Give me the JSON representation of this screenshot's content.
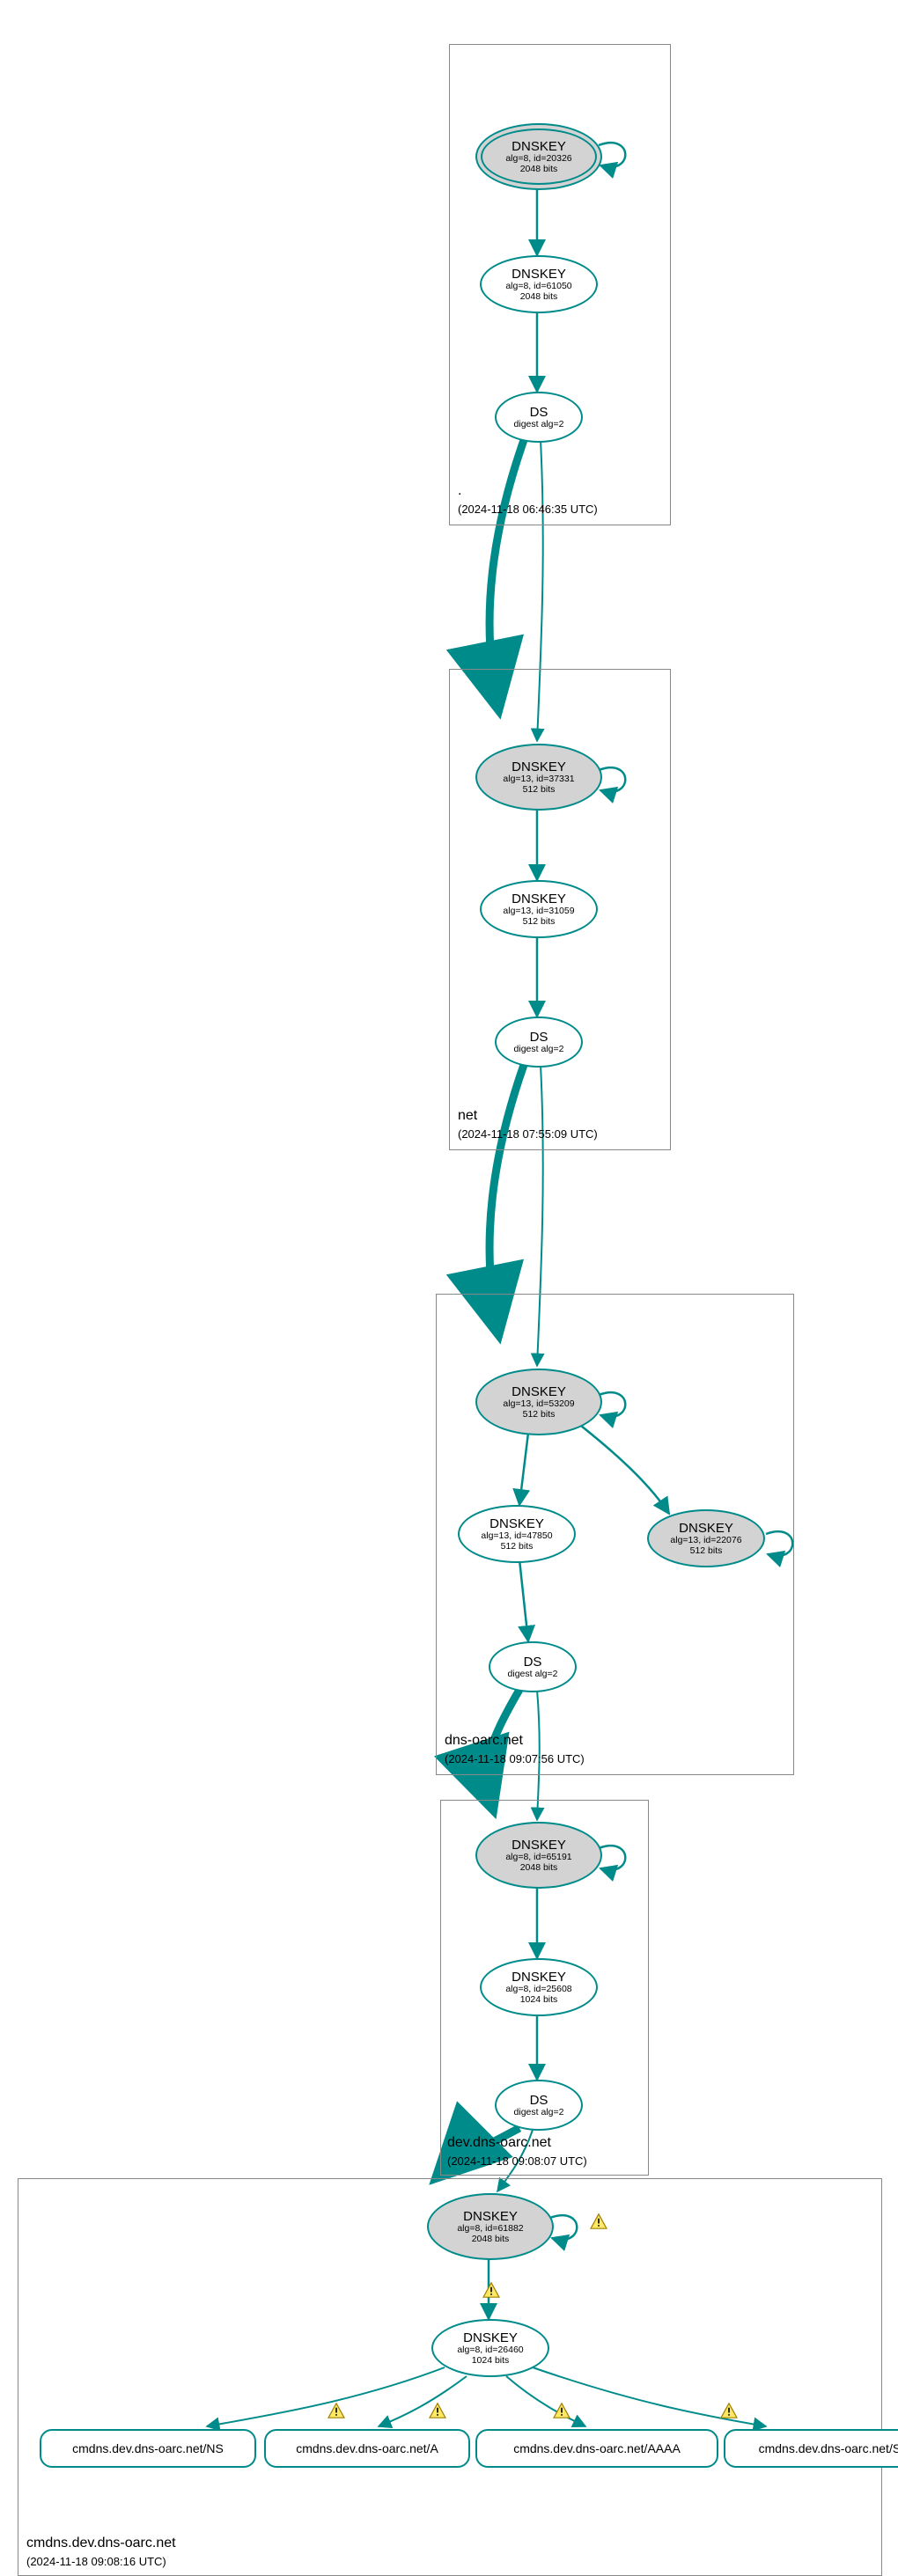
{
  "zones": {
    "root": {
      "name": ".",
      "timestamp": "(2024-11-18 06:46:35 UTC)"
    },
    "net": {
      "name": "net",
      "timestamp": "(2024-11-18 07:55:09 UTC)"
    },
    "dnsoarc": {
      "name": "dns-oarc.net",
      "timestamp": "(2024-11-18 09:07:56 UTC)"
    },
    "dev": {
      "name": "dev.dns-oarc.net",
      "timestamp": "(2024-11-18 09:08:07 UTC)"
    },
    "cmdns": {
      "name": "cmdns.dev.dns-oarc.net",
      "timestamp": "(2024-11-18 09:08:16 UTC)"
    }
  },
  "nodes": {
    "root_ksk": {
      "title": "DNSKEY",
      "sub1": "alg=8, id=20326",
      "sub2": "2048 bits"
    },
    "root_zsk": {
      "title": "DNSKEY",
      "sub1": "alg=8, id=61050",
      "sub2": "2048 bits"
    },
    "root_ds": {
      "title": "DS",
      "sub1": "digest alg=2"
    },
    "net_ksk": {
      "title": "DNSKEY",
      "sub1": "alg=13, id=37331",
      "sub2": "512 bits"
    },
    "net_zsk": {
      "title": "DNSKEY",
      "sub1": "alg=13, id=31059",
      "sub2": "512 bits"
    },
    "net_ds": {
      "title": "DS",
      "sub1": "digest alg=2"
    },
    "oarc_ksk": {
      "title": "DNSKEY",
      "sub1": "alg=13, id=53209",
      "sub2": "512 bits"
    },
    "oarc_zsk": {
      "title": "DNSKEY",
      "sub1": "alg=13, id=47850",
      "sub2": "512 bits"
    },
    "oarc_key2": {
      "title": "DNSKEY",
      "sub1": "alg=13, id=22076",
      "sub2": "512 bits"
    },
    "oarc_ds": {
      "title": "DS",
      "sub1": "digest alg=2"
    },
    "dev_ksk": {
      "title": "DNSKEY",
      "sub1": "alg=8, id=65191",
      "sub2": "2048 bits"
    },
    "dev_zsk": {
      "title": "DNSKEY",
      "sub1": "alg=8, id=25608",
      "sub2": "1024 bits"
    },
    "dev_ds": {
      "title": "DS",
      "sub1": "digest alg=2"
    },
    "cmdns_ksk": {
      "title": "DNSKEY",
      "sub1": "alg=8, id=61882",
      "sub2": "2048 bits"
    },
    "cmdns_zsk": {
      "title": "DNSKEY",
      "sub1": "alg=8, id=26460",
      "sub2": "1024 bits"
    }
  },
  "records": {
    "ns": "cmdns.dev.dns-oarc.net/NS",
    "a": "cmdns.dev.dns-oarc.net/A",
    "aaaa": "cmdns.dev.dns-oarc.net/AAAA",
    "soa": "cmdns.dev.dns-oarc.net/SOA"
  }
}
